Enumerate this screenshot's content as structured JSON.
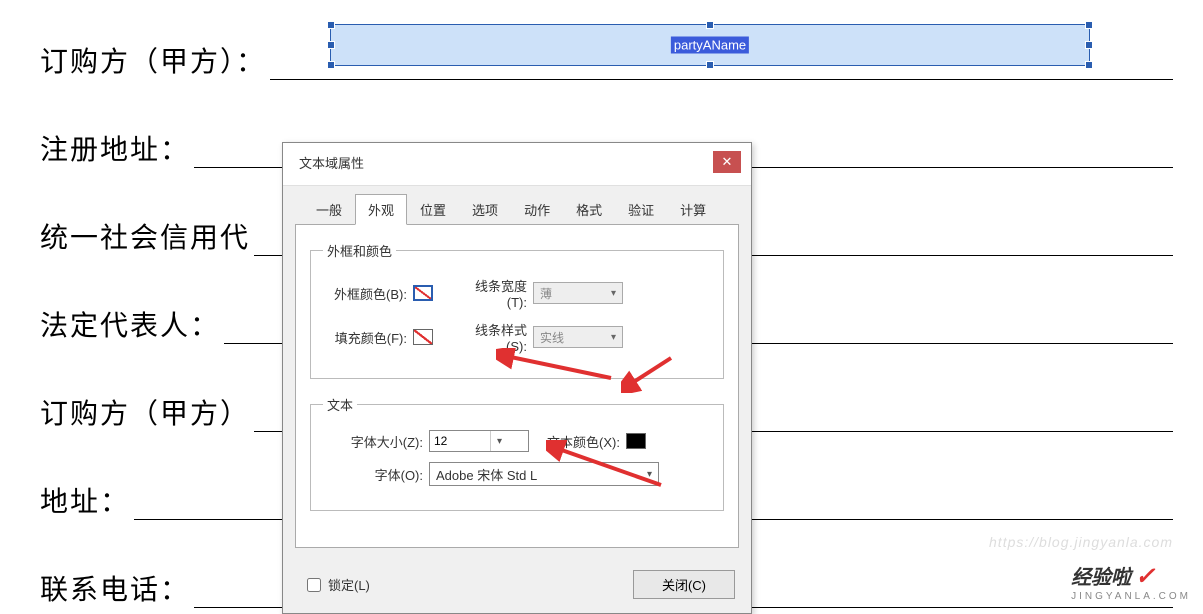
{
  "form": {
    "labels": [
      "订购方（甲方）：",
      "注册地址：",
      "统一社会信用代",
      "法定代表人：",
      "订购方（甲方）",
      "地址：",
      "联系电话："
    ]
  },
  "selected_field": {
    "name": "partyAName"
  },
  "dialog": {
    "title": "文本域属性",
    "tabs": [
      "一般",
      "外观",
      "位置",
      "选项",
      "动作",
      "格式",
      "验证",
      "计算"
    ],
    "active_tab": "外观",
    "groups": {
      "border": {
        "legend": "外框和颜色",
        "border_color_label": "外框颜色(B):",
        "line_width_label": "线条宽度(T):",
        "line_width_value": "薄",
        "fill_color_label": "填充颜色(F):",
        "line_style_label": "线条样式(S):",
        "line_style_value": "实线"
      },
      "text": {
        "legend": "文本",
        "font_size_label": "字体大小(Z):",
        "font_size_value": "12",
        "text_color_label": "文本颜色(X):",
        "font_label": "字体(O):",
        "font_value": "Adobe 宋体 Std L"
      }
    },
    "lock_label": "锁定(L)",
    "close_label": "关闭(C)"
  },
  "watermark": "https://blog.jingyanla.com",
  "logo": {
    "text": "经验啦",
    "check": "✓"
  }
}
